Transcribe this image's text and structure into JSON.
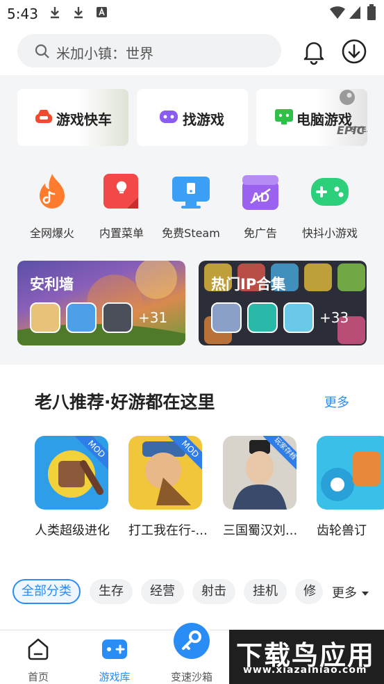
{
  "status": {
    "time": "5:43"
  },
  "header": {
    "search_placeholder": "米加小镇：世界"
  },
  "quick_cards": [
    {
      "label": "游戏快车"
    },
    {
      "label": "找游戏"
    },
    {
      "label": "电脑游戏"
    }
  ],
  "quick_card_logo_text": {
    "steam": "STEAM",
    "epic": "EPIC"
  },
  "features": [
    {
      "label": "全网爆火"
    },
    {
      "label": "内置菜单"
    },
    {
      "label": "免费Steam"
    },
    {
      "label": "免广告"
    },
    {
      "label": "快抖小游戏"
    }
  ],
  "banners": [
    {
      "title": "安利墙",
      "more": "+31"
    },
    {
      "title": "热门IP合集",
      "more": "+33"
    }
  ],
  "recommend": {
    "title": "老八推荐·好游都在这里",
    "more_label": "更多",
    "games": [
      {
        "name": "人类超级进化",
        "badge": "MOD"
      },
      {
        "name": "打工我在行-...",
        "badge": "MOD"
      },
      {
        "name": "三国蜀汉刘...",
        "badge": "玩家存档"
      },
      {
        "name": "齿轮兽订",
        "badge": ""
      }
    ]
  },
  "categories": {
    "items": [
      "全部分类",
      "生存",
      "经营",
      "射击",
      "挂机",
      "修"
    ],
    "more_label": "更多"
  },
  "nav": {
    "items": [
      {
        "label": "首页"
      },
      {
        "label": "游戏库"
      },
      {
        "label": "变速沙箱"
      }
    ]
  },
  "watermark": {
    "title": "下载鸟应用",
    "url": "www.xiazainiao.com"
  },
  "colors": {
    "accent": "#2a8cf5",
    "background": "#f4f5f7"
  }
}
